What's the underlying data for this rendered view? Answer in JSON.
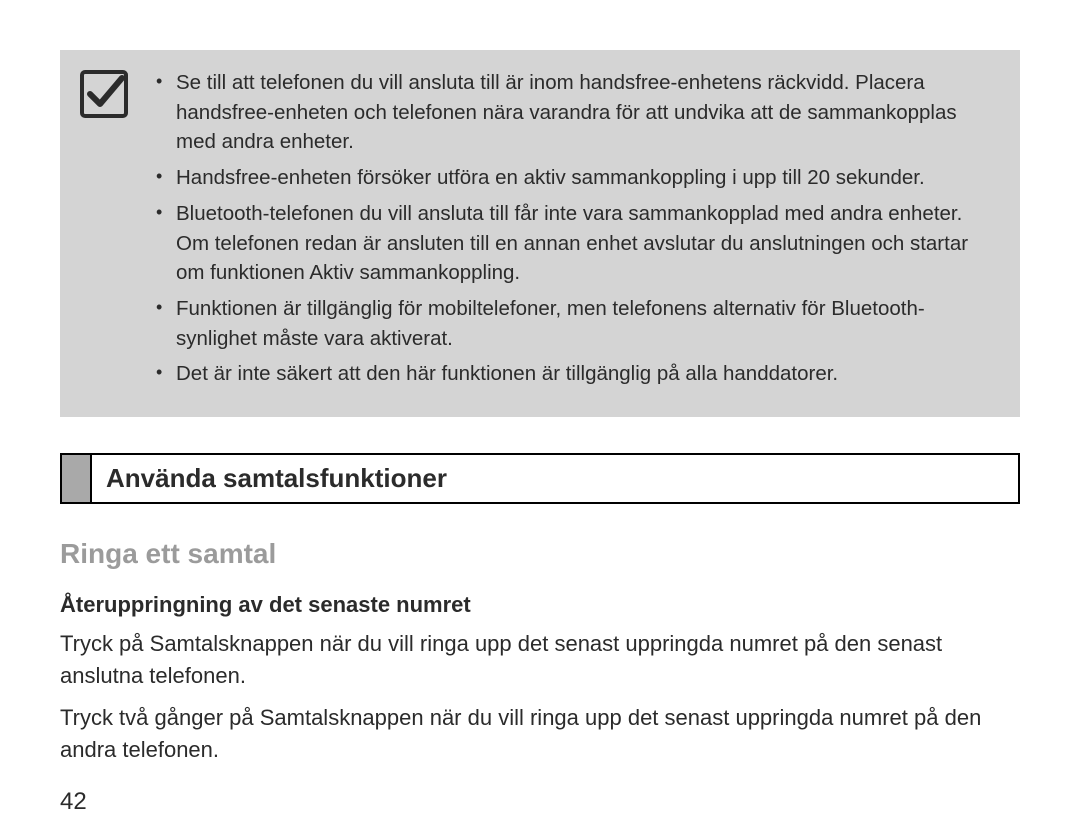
{
  "note": {
    "bullets": [
      "Se till att telefonen du vill ansluta till är inom handsfree-enhetens räckvidd. Placera handsfree-enheten och telefonen nära varandra för att undvika att de sammankopplas med andra enheter.",
      "Handsfree-enheten försöker utföra en aktiv sammankoppling i upp till 20 sekunder.",
      "Bluetooth-telefonen du vill ansluta till får inte vara sammankopplad med andra enheter. Om telefonen redan är ansluten till en annan enhet avslutar du anslutningen och startar om funktionen Aktiv sammankoppling.",
      "Funktionen är tillgänglig för mobiltelefoner, men telefonens alternativ för Bluetooth-synlighet måste vara aktiverat.",
      "Det är inte säkert att den här funktionen är tillgänglig på alla handdatorer."
    ]
  },
  "section_title": "Använda samtalsfunktioner",
  "subheading": "Ringa ett samtal",
  "subsub": "Återuppringning av det senaste numret",
  "paragraphs": [
    "Tryck på Samtalsknappen när du vill ringa upp det senast uppringda numret på den senast anslutna telefonen.",
    "Tryck två gånger på Samtalsknappen när du vill ringa upp det senast uppringda numret på den andra telefonen."
  ],
  "page_number": "42"
}
